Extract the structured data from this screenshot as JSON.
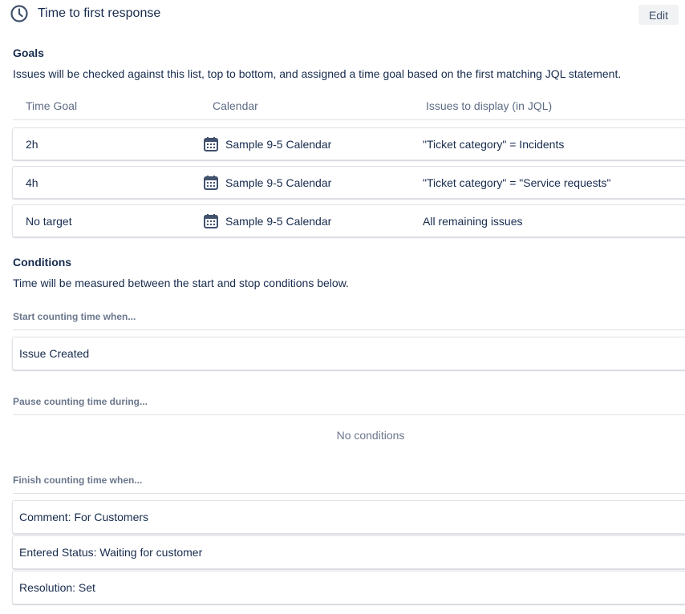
{
  "header": {
    "title": "Time to first response",
    "icon": "clock-icon",
    "edit_label": "Edit"
  },
  "goals": {
    "title": "Goals",
    "description": "Issues will be checked against this list, top to bottom, and assigned a time goal based on the first matching JQL statement.",
    "columns": [
      "Time Goal",
      "Calendar",
      "Issues to display (in JQL)"
    ],
    "rows": [
      {
        "time_goal": "2h",
        "calendar": "Sample 9-5 Calendar",
        "jql": "\"Ticket category\" = Incidents"
      },
      {
        "time_goal": "4h",
        "calendar": "Sample 9-5 Calendar",
        "jql": "\"Ticket category\" = \"Service requests\""
      },
      {
        "time_goal": "No target",
        "calendar": "Sample 9-5 Calendar",
        "jql": "All remaining issues"
      }
    ]
  },
  "conditions": {
    "title": "Conditions",
    "description": "Time will be measured between the start and stop conditions below.",
    "start": {
      "label": "Start counting time when...",
      "items": [
        "Issue Created"
      ]
    },
    "pause": {
      "label": "Pause counting time during...",
      "empty_text": "No conditions"
    },
    "finish": {
      "label": "Finish counting time when...",
      "items": [
        "Comment: For Customers",
        "Entered Status: Waiting for customer",
        "Resolution: Set"
      ]
    }
  },
  "colors": {
    "text": "#172b4d",
    "subtle": "#6b778c",
    "border": "#dfe1e6",
    "button_bg": "#f1f2f4"
  }
}
